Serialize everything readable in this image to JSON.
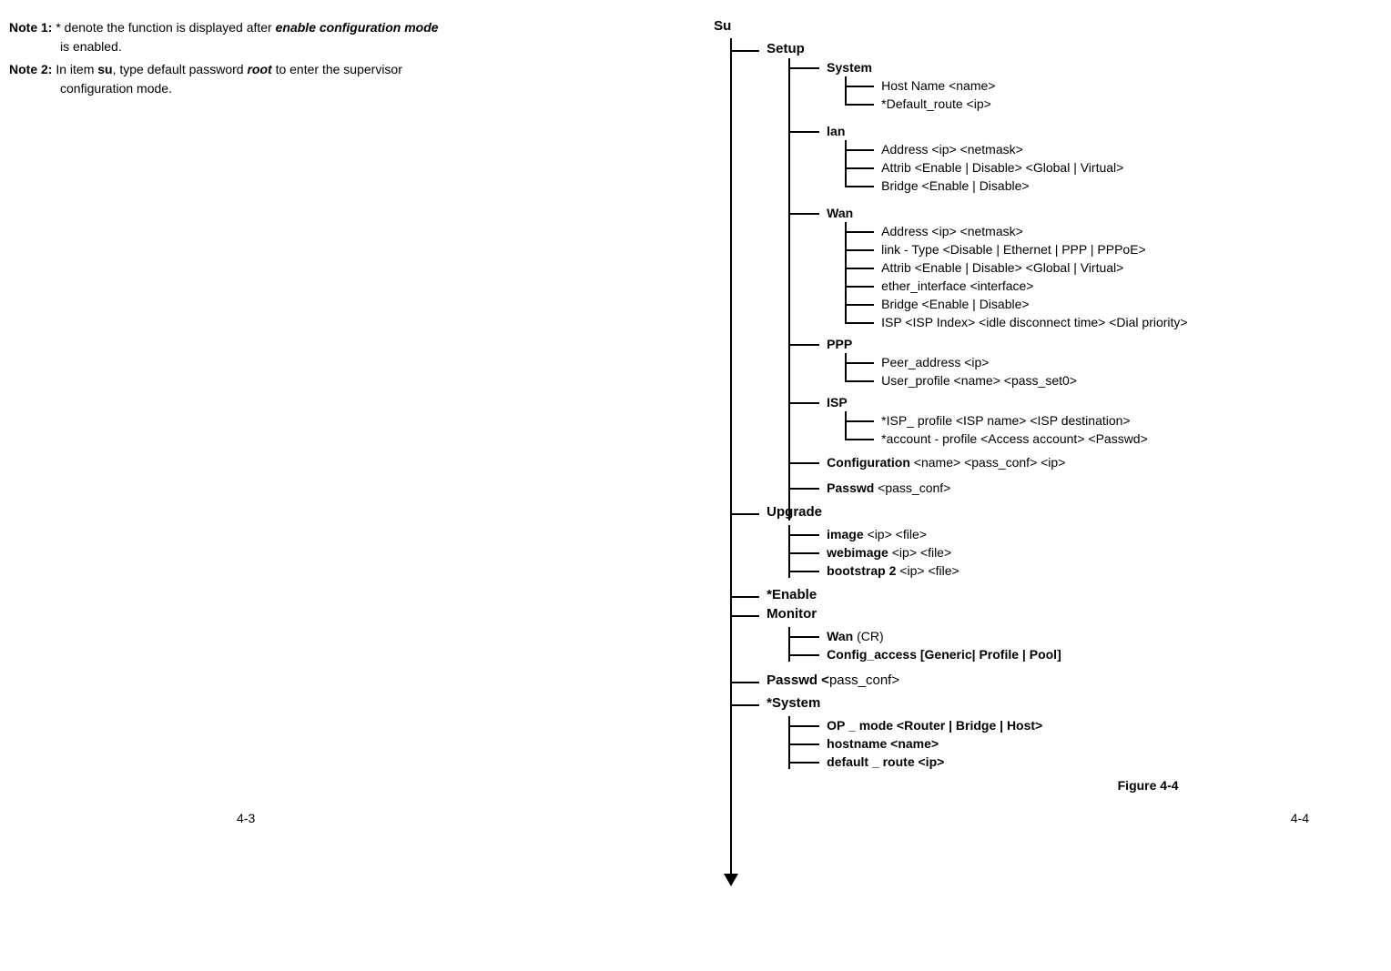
{
  "notes": {
    "n1_label": "Note 1:",
    "n1_a": " * denote the function is displayed after ",
    "n1_b": "enable configuration mode",
    "n1_c": "is enabled.",
    "n2_label": "Note 2:",
    "n2_a": " In item ",
    "n2_b": "su",
    "n2_c": ", type default password ",
    "n2_d": "root",
    "n2_e": " to enter the supervisor",
    "n2_f": "configuration mode."
  },
  "tree": {
    "root": "Su",
    "setup": {
      "label": "Setup",
      "system": {
        "label": "System",
        "items": [
          "Host Name  <name>",
          "*Default_route <ip>"
        ]
      },
      "lan": {
        "label": "lan",
        "items": [
          "Address <ip> <netmask>",
          "Attrib <Enable | Disable> <Global | Virtual>",
          "Bridge <Enable | Disable>"
        ]
      },
      "wan": {
        "label": "Wan",
        "items": [
          "Address <ip> <netmask>",
          "link - Type <Disable | Ethernet | PPP | PPPoE>",
          "Attrib <Enable | Disable> <Global | Virtual>",
          "ether_interface <interface>",
          "Bridge <Enable | Disable>",
          "ISP <ISP Index> <idle disconnect time> <Dial priority>"
        ]
      },
      "ppp": {
        "label": "PPP",
        "items": [
          "Peer_address <ip>",
          "User_profile <name> <pass_set0>"
        ]
      },
      "isp": {
        "label": "ISP",
        "items": [
          "*ISP_ profile <ISP name> <ISP destination>",
          "*account - profile <Access account> <Passwd>"
        ]
      },
      "configuration_b": "Configuration",
      "configuration_n": " <name> <pass_conf> <ip>",
      "passwd_b": "Passwd",
      "passwd_n": " <pass_conf>"
    },
    "upgrade": {
      "label": "Upgrade",
      "items_b": [
        "image",
        "webimage",
        "bootstrap 2"
      ],
      "items_n": [
        " <ip> <file>",
        " <ip> <file>",
        " <ip> <file>"
      ]
    },
    "enable": {
      "label": "*Enable"
    },
    "monitor": {
      "label": "Monitor",
      "wan_b": "Wan",
      "wan_n": " (CR)",
      "config": "Config_access [Generic| Profile | Pool]"
    },
    "passwd_b": "Passwd <",
    "passwd_n": "pass_conf>",
    "system": {
      "label": "*System",
      "items": [
        "OP _ mode <Router | Bridge | Host>",
        "hostname <name>",
        "default _ route <ip>"
      ]
    }
  },
  "figure": "Figure 4-4",
  "footer": {
    "left": "4-3",
    "right": "4-4"
  }
}
